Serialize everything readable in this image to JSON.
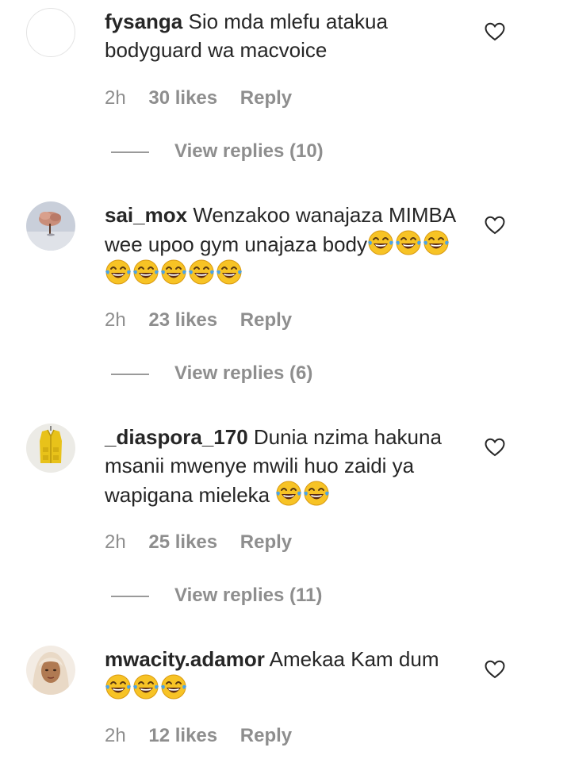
{
  "comments": [
    {
      "username": "fysanga",
      "text": "Sio mda mlefu atakua bodyguard wa macvoice",
      "emoji_count": 0,
      "time": "2h",
      "likes": "30 likes",
      "reply": "Reply",
      "view_replies": "View replies (10)",
      "avatar": "blank-avatar"
    },
    {
      "username": "sai_mox",
      "text": "Wenzakoo wanajaza MIMBA wee upoo gym unajaza body",
      "emoji_count": 8,
      "emoji": "face-with-tears-of-joy",
      "time": "2h",
      "likes": "23 likes",
      "reply": "Reply",
      "view_replies": "View replies (6)",
      "avatar": "tree-photo-avatar"
    },
    {
      "username": "_diaspora_170",
      "text": "Dunia nzima hakuna msanii mwenye mwili huo zaidi ya wapigana mieleka",
      "emoji_count": 2,
      "emoji": "face-with-tears-of-joy",
      "time": "2h",
      "likes": "25 likes",
      "reply": "Reply",
      "view_replies": "View replies (11)",
      "avatar": "yellow-vest-avatar"
    },
    {
      "username": "mwacity.adamor",
      "text": "Amekaa Kam dum",
      "emoji_count": 3,
      "emoji": "face-with-tears-of-joy",
      "time": "2h",
      "likes": "12 likes",
      "reply": "Reply",
      "avatar": "person-hijab-avatar"
    }
  ],
  "colors": {
    "text": "#262626",
    "secondary": "#8e8e8e",
    "background": "#ffffff"
  }
}
